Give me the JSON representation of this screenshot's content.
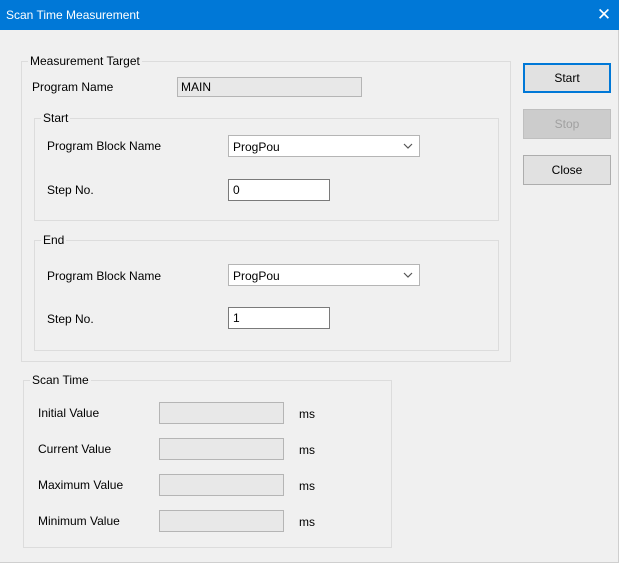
{
  "window": {
    "title": "Scan Time Measurement",
    "close_glyph": "✕"
  },
  "measurement_target": {
    "legend": "Measurement Target",
    "program_name_label": "Program Name",
    "program_name_value": "MAIN",
    "start": {
      "legend": "Start",
      "block_label": "Program Block Name",
      "block_value": "ProgPou",
      "step_label": "Step No.",
      "step_value": "0"
    },
    "end": {
      "legend": "End",
      "block_label": "Program Block Name",
      "block_value": "ProgPou",
      "step_label": "Step No.",
      "step_value": "1"
    }
  },
  "scan_time": {
    "legend": "Scan Time",
    "rows": [
      {
        "label": "Initial Value",
        "value": "",
        "unit": "ms"
      },
      {
        "label": "Current Value",
        "value": "",
        "unit": "ms"
      },
      {
        "label": "Maximum Value",
        "value": "",
        "unit": "ms"
      },
      {
        "label": "Minimum Value",
        "value": "",
        "unit": "ms"
      }
    ]
  },
  "buttons": {
    "start": "Start",
    "stop": "Stop",
    "close": "Close"
  },
  "icons": {
    "combo_arrow": "chevron-down-icon",
    "window_close": "close-icon"
  },
  "colors": {
    "titlebar": "#0078d7",
    "default_button_border": "#0078d7"
  }
}
